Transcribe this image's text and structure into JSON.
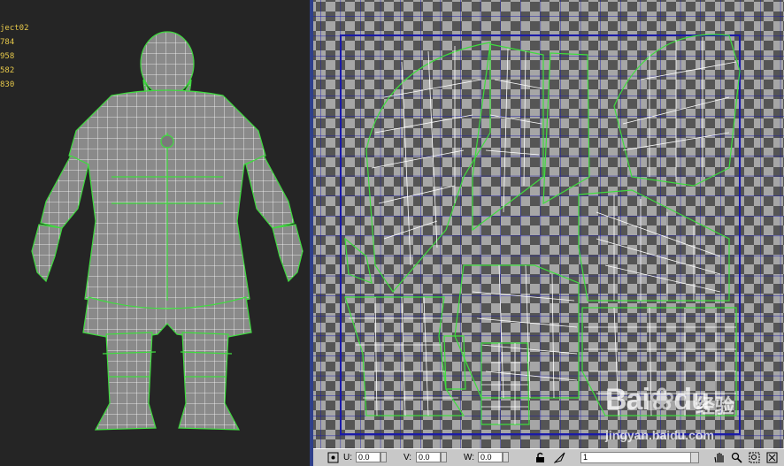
{
  "viewport": {
    "object_name": "ject02",
    "stats": [
      "784",
      "958",
      "582",
      "830"
    ]
  },
  "uv_toolbar": {
    "u_label": "U:",
    "u_value": "0.0",
    "v_label": "V:",
    "v_value": "0.0",
    "w_label": "W:",
    "w_value": "0.0",
    "channel_value": "1"
  },
  "watermark": {
    "logo_text": "Bai",
    "logo_text2": "du",
    "logo_cn": "经验",
    "url": "jingyan.baidu.com"
  },
  "colors": {
    "wire_green": "#3fdc3f",
    "uv_tile_dark": "#555555",
    "uv_tile_light": "#a6a6a6",
    "uv_grid_blue": "#1a1aa8",
    "stat_yellow": "#e6c84a"
  },
  "icons": [
    "pan-hand-icon",
    "zoom-icon",
    "zoom-region-icon",
    "zoom-extents-icon",
    "lock-icon",
    "freeform-icon",
    "transform-icon"
  ]
}
